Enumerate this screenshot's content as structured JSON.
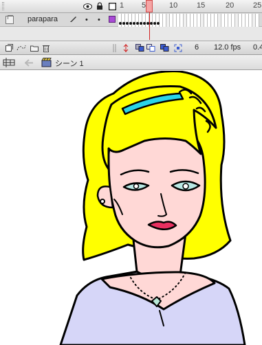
{
  "timeline": {
    "ruler_numbers": [
      "1",
      "5",
      "10",
      "15",
      "20",
      "25"
    ],
    "current_frame": "6",
    "frame_rate": "12.0 fps",
    "elapsed": "0.4"
  },
  "layers": [
    {
      "name": "parapara",
      "color": "#a94bd6",
      "keyframes": 12
    }
  ],
  "editbar": {
    "scene_label": "シーン 1"
  },
  "colors": {
    "hair": "#ffff00",
    "skin": "#ffd8d6",
    "shirt": "#d6d6f8",
    "headband": "#2ad4e8",
    "lips": "#e83060",
    "eyes": "#b8e8e4",
    "pendant": "#b8e8d8"
  },
  "icons": {
    "eye": "eye-icon",
    "lock": "lock-icon",
    "outline": "outline-square-icon",
    "pencil": "pencil-icon"
  }
}
